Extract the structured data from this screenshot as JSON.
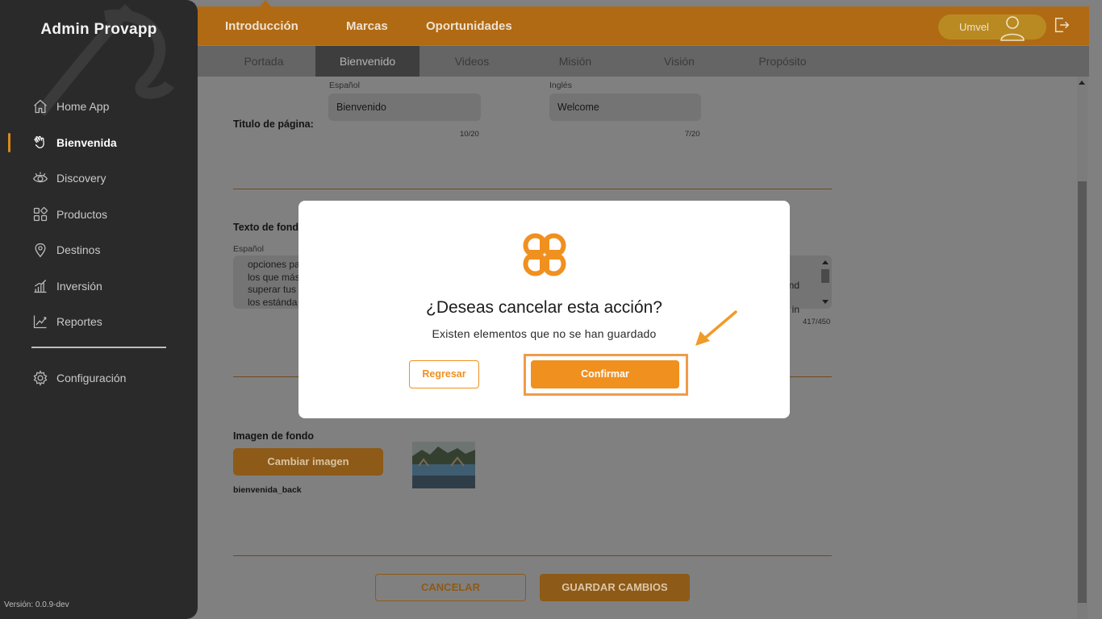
{
  "app": {
    "title": "Admin Provapp",
    "version": "Versión: 0.0.9-dev"
  },
  "sidebar": {
    "items": [
      {
        "label": "Home App",
        "icon": "home-icon"
      },
      {
        "label": "Bienvenida",
        "icon": "hand-wave-icon",
        "active": true
      },
      {
        "label": "Discovery",
        "icon": "eye-icon"
      },
      {
        "label": "Productos",
        "icon": "grid-icon"
      },
      {
        "label": "Destinos",
        "icon": "map-pin-icon"
      },
      {
        "label": "Inversión",
        "icon": "bar-chart-icon"
      },
      {
        "label": "Reportes",
        "icon": "line-chart-icon"
      }
    ],
    "config": {
      "label": "Configuración",
      "icon": "gear-icon"
    }
  },
  "topbar": {
    "tabs": [
      "Introducción",
      "Marcas",
      "Oportunidades"
    ],
    "user": "Umvel"
  },
  "subtabs": [
    "Portada",
    "Bienvenido",
    "Videos",
    "Misión",
    "Visión",
    "Propósito"
  ],
  "form": {
    "title_label": "Titulo de página:",
    "lang_es": "Español",
    "lang_en": "Inglés",
    "title_es": "Bienvenido",
    "title_en": "Welcome",
    "title_es_count": "10/20",
    "title_en_count": "7/20",
    "text_label": "Texto de fond",
    "text_lang_es": "Español",
    "text_es_lines": [
      "opciones pa",
      "los que más",
      "superar tus",
      "los estánda"
    ],
    "text_en_lines": [
      "nd",
      "in"
    ],
    "text_count": "417/450",
    "image_label": "Imagen de fondo",
    "change_image": "Cambiar imagen",
    "image_name": "bienvenida_back",
    "cancel": "CANCELAR",
    "save": "GUARDAR CAMBIOS"
  },
  "modal": {
    "title": "¿Deseas cancelar esta acción?",
    "subtitle": "Existen elementos que no se han guardado",
    "back": "Regresar",
    "confirm": "Confirmar"
  },
  "colors": {
    "accent": "#f0901f",
    "brand_dark": "#b06a14",
    "sidebar_bg": "#2a2a2a"
  }
}
